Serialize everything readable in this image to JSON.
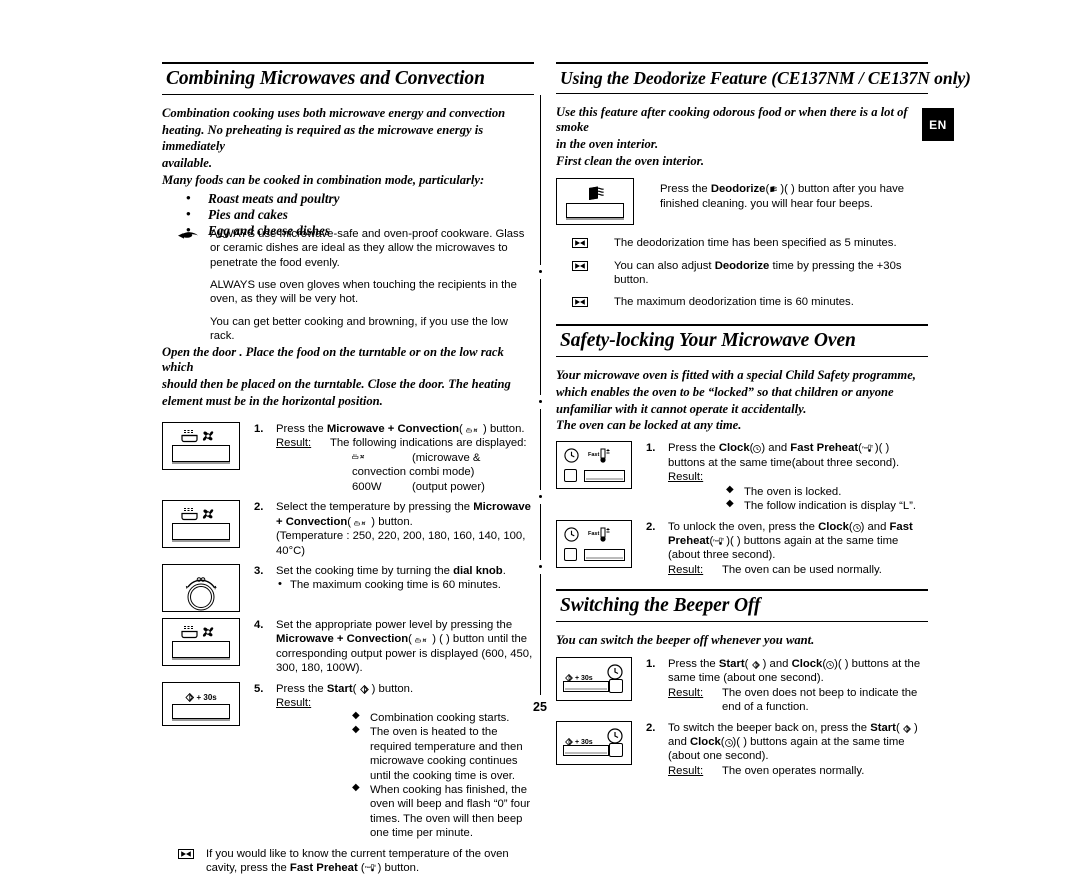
{
  "page": {
    "number": "25",
    "language_tab": "EN"
  },
  "left_column": {
    "heading": "Combining Microwaves and Convection",
    "intro_lines": [
      "Combination cooking uses both microwave energy and convection",
      "heating. No preheating is required as the microwave energy is immediately",
      "available.",
      "Many foods can be cooked in combination mode, particularly:"
    ],
    "food_bullets": [
      "Roast meats and poultry",
      "Pies and cakes",
      "Egg and cheese dishes"
    ],
    "hand_notes": [
      "ALWAYS use microwave-safe and oven-proof cookware. Glass or ceramic dishes are ideal as they allow the microwaves to penetrate the food evenly.",
      "ALWAYS use oven gloves when touching the recipients in the oven, as they will be very hot.",
      "You can get better cooking and browning, if you use the low rack."
    ],
    "door_note_lines": [
      "Open the door . Place the food on the turntable or on the low rack which",
      "should then be placed on the turntable. Close the door. The heating",
      "element must be in the horizontal position."
    ],
    "steps": [
      {
        "num": "1.",
        "panel": "mw-convection",
        "line1_pre": "Press the ",
        "line1_bold": "Microwave + Convection",
        "line1_post": "( ) button.",
        "result_label": "Result:",
        "result_value": "The following indications are displayed:",
        "extra_rows": [
          {
            "icon": "mw-conv-glyph",
            "text": "(microwave & convection combi mode)"
          },
          {
            "icon": "",
            "label": "600W",
            "text": "(output power)"
          }
        ]
      },
      {
        "num": "2.",
        "panel": "mw-convection",
        "line1_pre": "Select the temperature by pressing the ",
        "line1_bold": "Microwave + Convection",
        "line1_post": "( ) button.",
        "temp_line": "(Temperature : 250, 220, 200, 180, 160, 140, 100, 40°C)"
      },
      {
        "num": "3.",
        "panel": "dial",
        "line1_pre": "Set the cooking time by turning the ",
        "line1_bold": "dial knob",
        "line1_post": ".",
        "sub_bullets": [
          "The maximum cooking time is 60 minutes."
        ]
      },
      {
        "num": "4.",
        "panel": "mw-convection",
        "line1_pre": "Set the appropriate power level by pressing the",
        "line2_bold": "Microwave + Convection",
        "line2_post": "( ) button until the corresponding output power is displayed (600, 450, 300, 180, 100W)."
      },
      {
        "num": "5.",
        "panel": "start30",
        "line1_pre": "Press the ",
        "line1_bold": "Start",
        "line1_post": "( ) button.",
        "result_label": "Result:",
        "diamonds": [
          "Combination cooking starts.",
          "The oven is heated to the required temperature and then microwave cooking continues until the cooking time is over.",
          "When cooking has finished, the oven will beep and flash “0” four times. The oven will then beep one time per minute."
        ]
      }
    ],
    "final_note": {
      "icon": "note-icon",
      "pre": "If you would like to know the current temperature of the oven cavity, press the ",
      "bold": "Fast Preheat",
      "post": " ( ) button."
    }
  },
  "right_column": {
    "section_deodorize": {
      "heading": "Using the Deodorize Feature (CE137NM / CE137N only)",
      "intro_lines": [
        "Use this feature after cooking odorous food or when there is a lot of smoke",
        "in the oven interior.",
        "First clean the oven interior."
      ],
      "panel_text_pre": "Press the ",
      "panel_text_bold": "Deodorize",
      "panel_text_post": "( ) button after you have finished cleaning. you will hear four beeps.",
      "notes": [
        {
          "pre": "The deodorization time has been specified as 5 minutes.",
          "bold": "",
          "post": ""
        },
        {
          "pre": "You can also adjust ",
          "bold": "Deodorize",
          "post": " time by pressing the +30s button."
        },
        {
          "pre": "The maximum deodorization time is 60 minutes.",
          "bold": "",
          "post": ""
        }
      ]
    },
    "section_safety": {
      "heading": "Safety-locking Your Microwave Oven",
      "intro_lines": [
        "Your microwave oven is fitted with a special Child Safety programme,",
        "which enables the oven to be “locked” so that children or anyone",
        "unfamiliar with it cannot operate it accidentally.",
        "The oven can be locked at any time."
      ],
      "steps": [
        {
          "num": "1.",
          "panel": "clock-fastpreheat",
          "text_pre": "Press the ",
          "bold1": "Clock",
          "mid": "( ) and ",
          "bold2": "Fast Preheat",
          "text_post": "( ) buttons at the same time(about three second).",
          "result_label": "Result:",
          "diamonds": [
            "The oven is locked.",
            "The follow indication is display “L”."
          ]
        },
        {
          "num": "2.",
          "panel": "clock-fastpreheat",
          "text_pre": "To unlock the oven, press the ",
          "bold1": "Clock",
          "mid": "( ) and ",
          "bold2": "Fast Preheat",
          "text_post": "( ) buttons again at the same time (about three second).",
          "result_label": "Result:",
          "result_value": "The oven can be used normally."
        }
      ]
    },
    "section_beeper": {
      "heading": "Switching the Beeper Off",
      "intro": "You can switch the beeper off whenever you want.",
      "steps": [
        {
          "num": "1.",
          "panel": "start-clock",
          "text_pre": "Press the ",
          "bold1": "Start",
          "mid": "( ) and ",
          "bold2": "Clock",
          "text_post": "( ) buttons at the same time (about one second).",
          "result_label": "Result:",
          "result_value": "The oven does not beep to indicate the end of a function."
        },
        {
          "num": "2.",
          "panel": "start-clock",
          "text_pre": "To switch the beeper back on, press the ",
          "bold1": "Start",
          "mid": "( ) and ",
          "bold2": "Clock",
          "text_post": "( ) buttons again at the same time (about one second).",
          "result_label": "Result:",
          "result_value": "The oven operates normally."
        }
      ]
    }
  },
  "icons": {
    "mw_convection": "microwave-convection-icon",
    "dial_knob": "dial-knob-icon",
    "start": "start-icon",
    "clock": "clock-icon",
    "fast_preheat": "fast-preheat-icon",
    "deodorize": "deodorize-icon",
    "note": "note-icon",
    "hand_pointer": "hand-pointer-icon"
  }
}
